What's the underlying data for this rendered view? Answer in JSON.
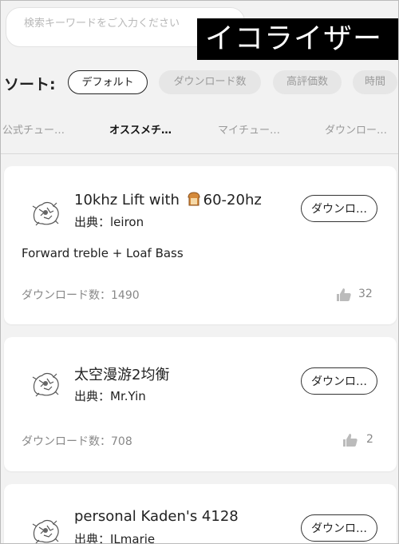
{
  "search": {
    "placeholder": "検索キーワードをご入力ください"
  },
  "banner": {
    "title": "イコライザー"
  },
  "sort": {
    "label": "ソート:",
    "options": [
      "デフォルト",
      "ダウンロード数",
      "高評価数",
      "時間"
    ],
    "selected": "デフォルト"
  },
  "tabs": [
    {
      "label": "公式チュー…",
      "active": false
    },
    {
      "label": "オススメチ…",
      "active": true
    },
    {
      "label": "マイチュー…",
      "active": false
    },
    {
      "label": "ダウンロー…",
      "active": false
    }
  ],
  "cards": [
    {
      "title_pre": "10khz Lift with ",
      "title_post": "60-20hz",
      "title_emoji": "bread-icon",
      "source": "出典：leiron",
      "button": "ダウンロ…",
      "description": "Forward treble + Loaf Bass",
      "downloads": "ダウンロード数：1490",
      "likes": "32"
    },
    {
      "title": "太空漫游2均衡",
      "source": "出典：Mr.Yin",
      "button": "ダウンロ…",
      "downloads": "ダウンロード数：708",
      "likes": "2"
    },
    {
      "title": "personal Kaden's 4128",
      "source": "出典：ILmarie",
      "button": "ダウンロ…"
    }
  ],
  "colors": {
    "banner_bg": "#000000",
    "chip_inactive_bg": "#e6e6e6",
    "muted_text": "#888888"
  }
}
